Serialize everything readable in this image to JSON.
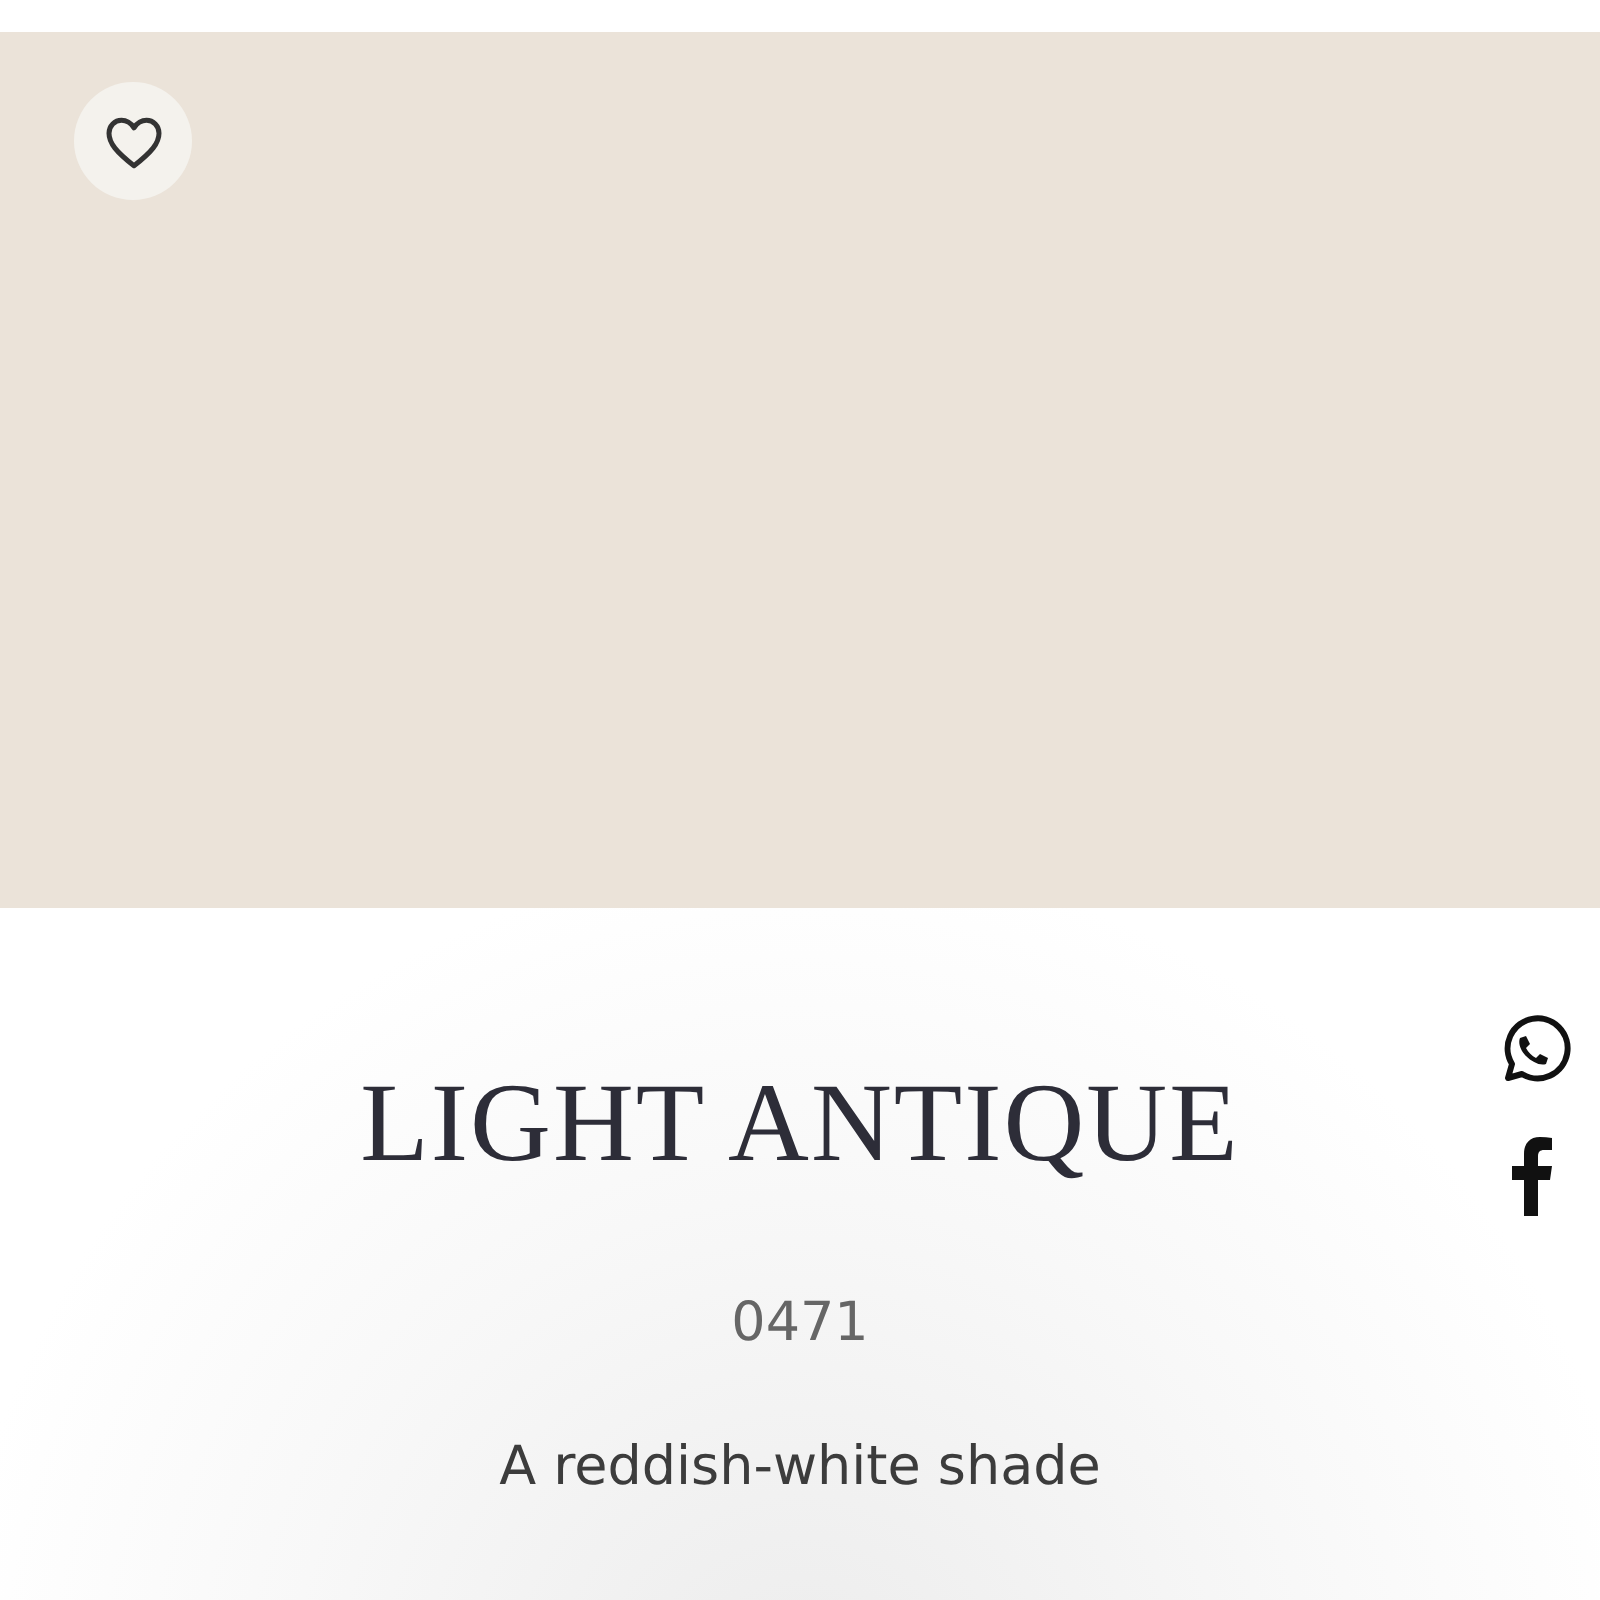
{
  "swatch": {
    "color": "#ebe3d9",
    "favorited": false
  },
  "share": [
    {
      "kind": "whatsapp"
    },
    {
      "kind": "facebook"
    }
  ],
  "title": "LIGHT ANTIQUE",
  "code": "0471",
  "description": "A reddish-white shade"
}
